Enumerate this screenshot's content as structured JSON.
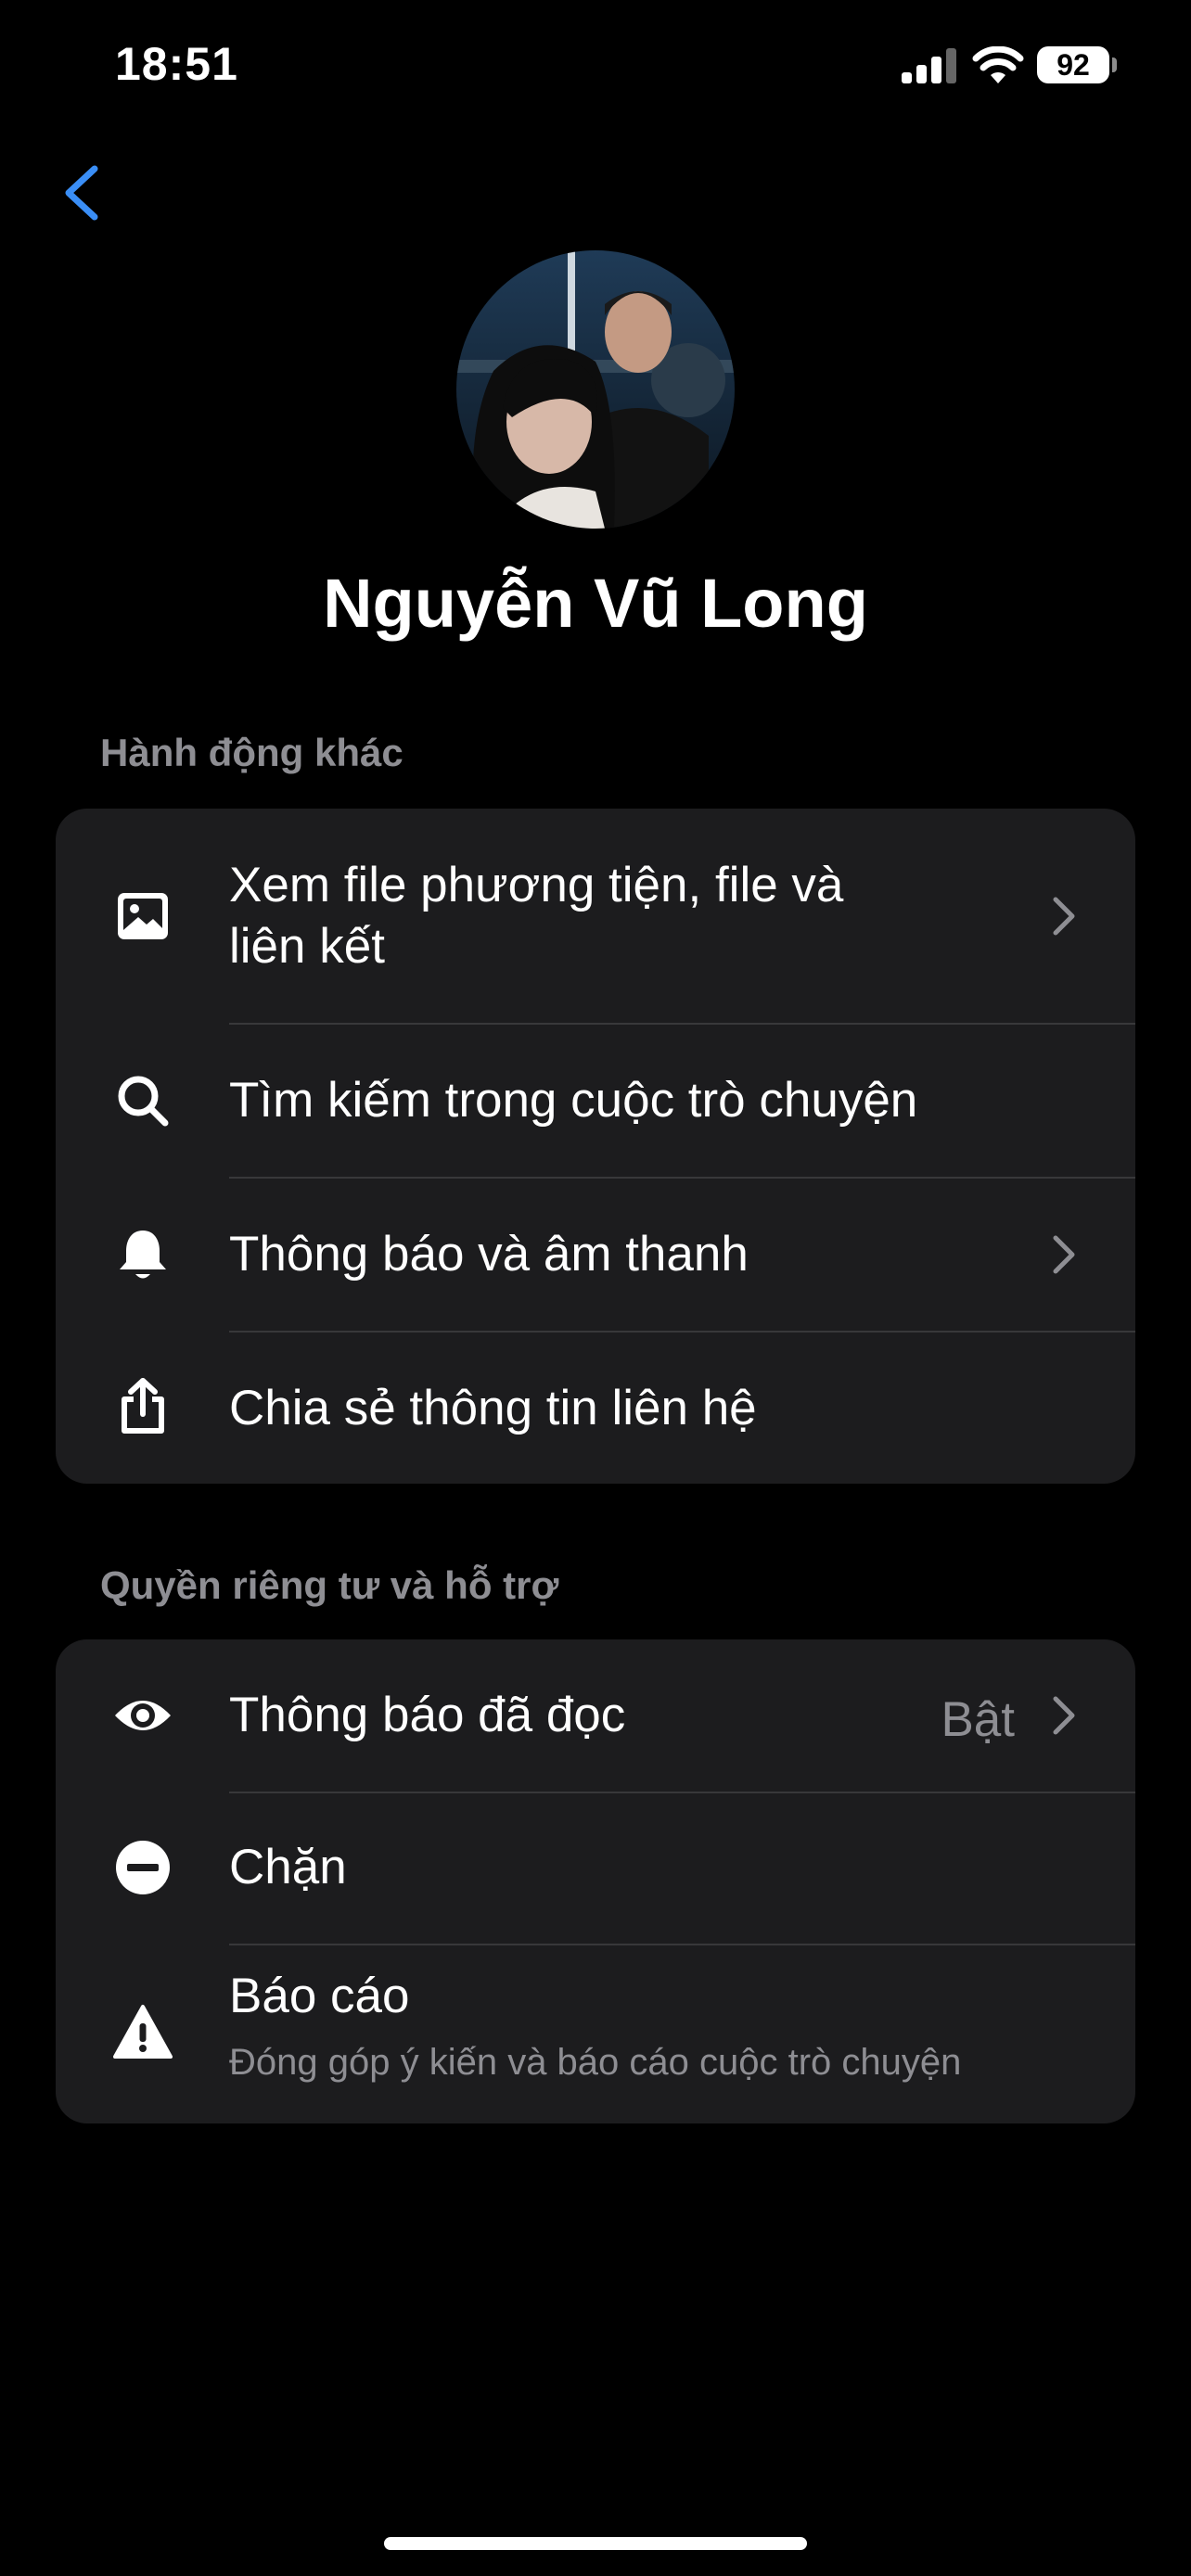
{
  "status_bar": {
    "time": "18:51",
    "battery": "92"
  },
  "profile": {
    "name": "Nguyễn Vũ Long"
  },
  "sections": {
    "actions": {
      "title": "Hành động khác",
      "media_line1": "Xem file phương tiện, file và",
      "media_line2": "liên kết",
      "search": "Tìm kiếm trong cuộc trò chuyện",
      "notifications": "Thông báo và âm thanh",
      "share": "Chia sẻ thông tin liên hệ"
    },
    "privacy": {
      "title": "Quyền riêng tư và hỗ trợ",
      "read_receipts": "Thông báo đã đọc",
      "read_receipts_value": "Bật",
      "block": "Chặn",
      "report": "Báo cáo",
      "report_sub": "Đóng góp ý kiến và báo cáo cuộc trò chuyện"
    }
  },
  "icons": {
    "back": "chevron-left-icon",
    "media": "image-icon",
    "search": "search-icon",
    "notifications": "bell-icon",
    "share": "share-icon",
    "read_receipts": "eye-icon",
    "block": "block-icon",
    "report": "warning-icon"
  },
  "colors": {
    "accent": "#3a8ef6",
    "background": "#000000",
    "card": "#1c1c1e",
    "secondary_text": "#8e8e93"
  }
}
